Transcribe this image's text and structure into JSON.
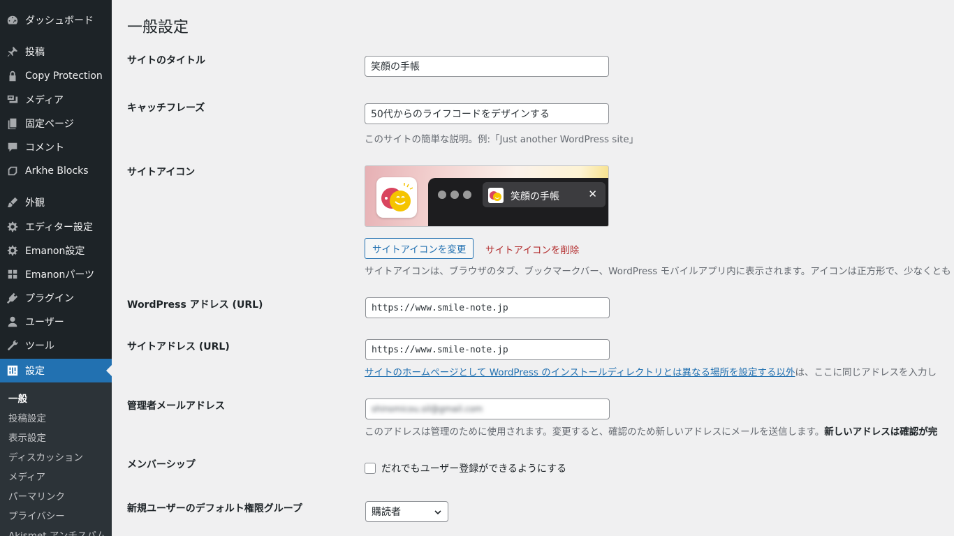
{
  "sidebar": {
    "items": [
      {
        "label": "ダッシュボード",
        "icon": "dashboard-icon"
      },
      {
        "label": "投稿",
        "icon": "pin-icon"
      },
      {
        "label": "Copy Protection",
        "icon": "lock-icon"
      },
      {
        "label": "メディア",
        "icon": "media-icon"
      },
      {
        "label": "固定ページ",
        "icon": "page-icon"
      },
      {
        "label": "コメント",
        "icon": "comment-icon"
      },
      {
        "label": "Arkhe Blocks",
        "icon": "blocks-icon"
      },
      {
        "label": "外観",
        "icon": "brush-icon"
      },
      {
        "label": "エディター設定",
        "icon": "gear-icon"
      },
      {
        "label": "Emanon設定",
        "icon": "gear-icon"
      },
      {
        "label": "Emanonパーツ",
        "icon": "grid-icon"
      },
      {
        "label": "プラグイン",
        "icon": "plugin-icon"
      },
      {
        "label": "ユーザー",
        "icon": "user-icon"
      },
      {
        "label": "ツール",
        "icon": "wrench-icon"
      },
      {
        "label": "設定",
        "icon": "settings-icon"
      }
    ],
    "submenu": [
      "一般",
      "投稿設定",
      "表示設定",
      "ディスカッション",
      "メディア",
      "パーマリンク",
      "プライバシー",
      "Akismet アンチスパム"
    ]
  },
  "page": {
    "title": "一般設定"
  },
  "fields": {
    "site_title": {
      "label": "サイトのタイトル",
      "value": "笑顔の手帳"
    },
    "tagline": {
      "label": "キャッチフレーズ",
      "value": "50代からのライフコードをデザインする",
      "description": "このサイトの簡単な説明。例:「Just another WordPress site」"
    },
    "site_icon": {
      "label": "サイトアイコン",
      "tab_title": "笑顔の手帳",
      "tab_close": "✕",
      "change_button": "サイトアイコンを変更",
      "delete_link": "サイトアイコンを削除",
      "description": "サイトアイコンは、ブラウザのタブ、ブックマークバー、WordPress モバイルアプリ内に表示されます。アイコンは正方形で、少なくとも"
    },
    "wp_address": {
      "label": "WordPress アドレス (URL)",
      "value": "https://www.smile-note.jp"
    },
    "site_address": {
      "label": "サイトアドレス (URL)",
      "value": "https://www.smile-note.jp",
      "description_link": "サイトのホームページとして WordPress のインストールディレクトリとは異なる場所を設定する以外",
      "description_rest": "は、ここに同じアドレスを入力し"
    },
    "admin_email": {
      "label": "管理者メールアドレス",
      "value": "shinsmicou.sil@gmail.com",
      "description": "このアドレスは管理のために使用されます。変更すると、確認のため新しいアドレスにメールを送信します。",
      "description_bold": "新しいアドレスは確認が完"
    },
    "membership": {
      "label": "メンバーシップ",
      "checkbox_label": "だれでもユーザー登録ができるようにする"
    },
    "default_role": {
      "label": "新規ユーザーのデフォルト権限グループ",
      "selected": "購読者"
    }
  },
  "colors": {
    "sidebar_bg": "#1d2327",
    "accent": "#2271b1",
    "delete": "#b32d2e"
  }
}
